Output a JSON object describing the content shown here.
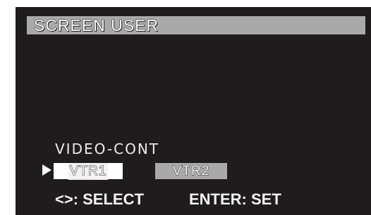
{
  "header": {
    "title": "SCREEN USER"
  },
  "menu": {
    "heading": "VIDEO-CONT",
    "options": [
      {
        "label": "VTR1",
        "selected": true
      },
      {
        "label": "VTR2",
        "selected": false
      }
    ],
    "cursor_icon": "triangle-right-icon"
  },
  "footer": {
    "select_hint": "<>: SELECT",
    "enter_hint": "ENTER: SET"
  },
  "colors": {
    "background": "#1e1c1c",
    "highlight": "#a9a9a9",
    "selected": "#ffffff",
    "text": "#ffffff"
  }
}
